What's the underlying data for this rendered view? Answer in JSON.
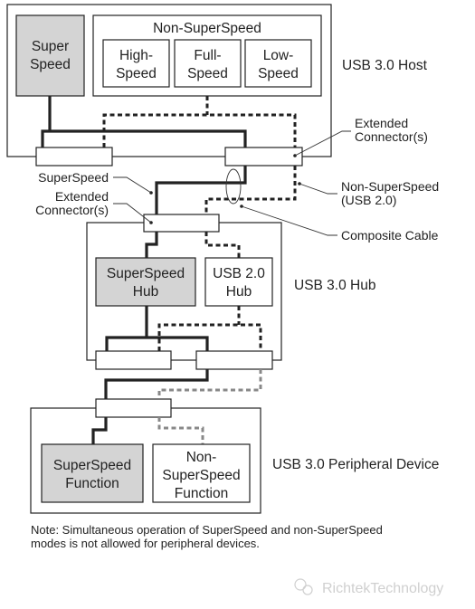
{
  "host": {
    "title": "USB 3.0 Host",
    "superspeed": [
      "Super",
      "Speed"
    ],
    "non_superspeed_title": "Non-SuperSpeed",
    "high": [
      "High-",
      "Speed"
    ],
    "full": [
      "Full-",
      "Speed"
    ],
    "low": [
      "Low-",
      "Speed"
    ]
  },
  "hub": {
    "title": "USB 3.0 Hub",
    "superspeed_hub": [
      "SuperSpeed",
      "Hub"
    ],
    "usb2_hub": [
      "USB 2.0",
      "Hub"
    ]
  },
  "device": {
    "title": "USB 3.0 Peripheral Device",
    "ss_function": [
      "SuperSpeed",
      "Function"
    ],
    "nss_function": [
      "Non-",
      "SuperSpeed",
      "Function"
    ]
  },
  "callouts": {
    "extended_connector_right": [
      "Extended",
      "Connector(s)"
    ],
    "superspeed": "SuperSpeed",
    "extended_connector_left": [
      "Extended",
      "Connector(s)"
    ],
    "non_superspeed": [
      "Non-SuperSpeed",
      "(USB 2.0)"
    ],
    "composite_cable": "Composite Cable"
  },
  "note": [
    "Note: Simultaneous operation of SuperSpeed and non-SuperSpeed",
    "modes is not allowed for peripheral devices."
  ],
  "watermark": "RichtekTechnology",
  "colors": {
    "superspeed_fill": "#d4d4d4",
    "line": "#222222",
    "device_usb2_line": "#888888"
  }
}
